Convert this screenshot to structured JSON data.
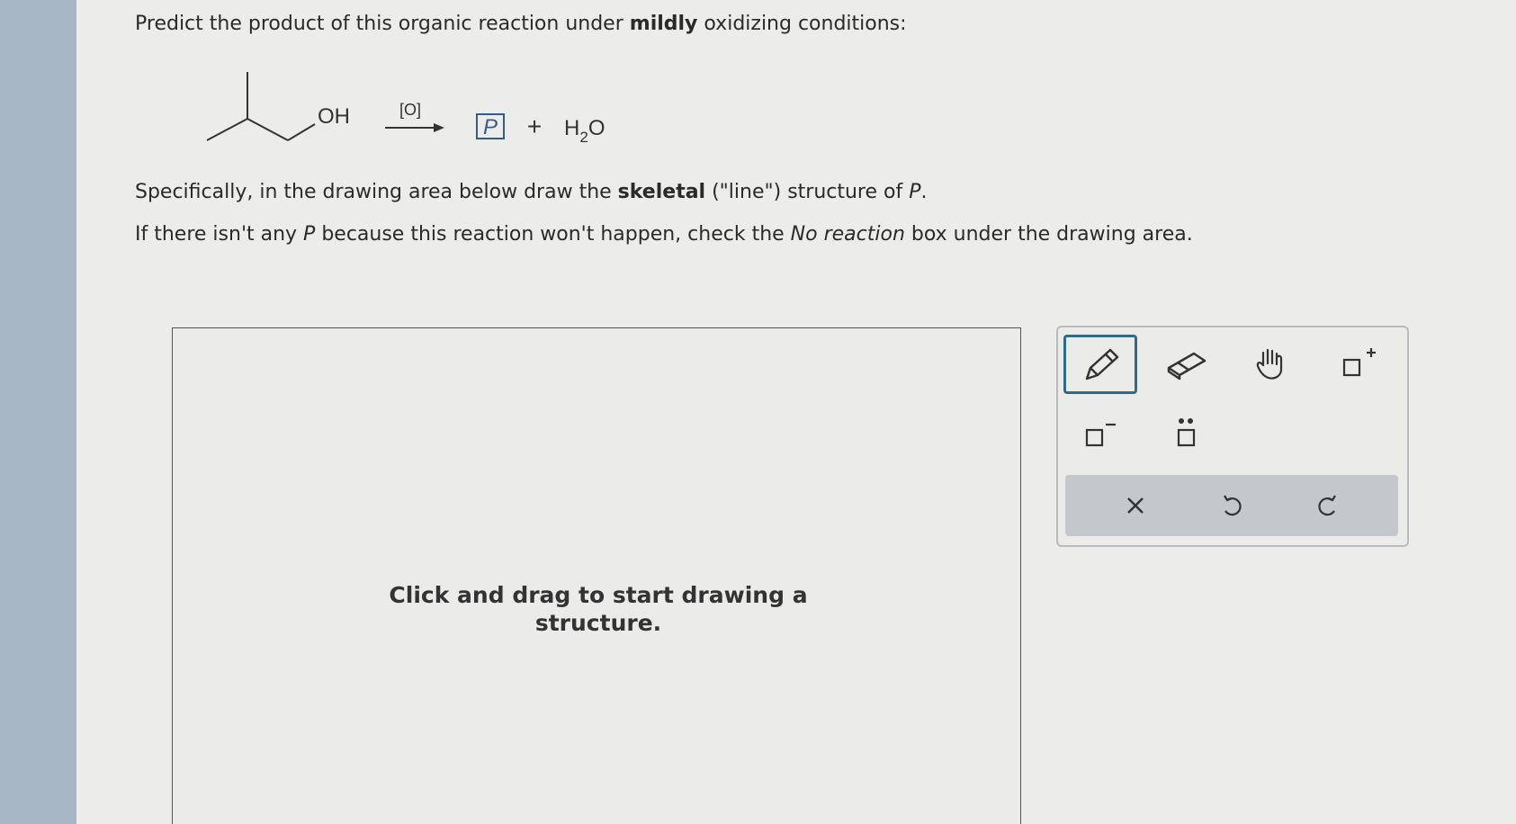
{
  "question": {
    "line1_pre": "Predict the product of this organic reaction under ",
    "line1_bold": "mildly",
    "line1_post": " oxidizing conditions:",
    "line2_pre": "Specifically, in the drawing area below draw the ",
    "line2_bold": "skeletal",
    "line2_mid": " (\"line\") structure of ",
    "line2_var": "P",
    "line2_post": ".",
    "line3_pre": "If there isn't any ",
    "line3_var": "P",
    "line3_mid": " because this reaction won't happen, check the ",
    "line3_ital": "No reaction",
    "line3_post": " box under the drawing area."
  },
  "reaction": {
    "reactant_label": "OH",
    "reagent": "[O]",
    "product_box": "P",
    "plus": "+",
    "byproduct_main": "H",
    "byproduct_sub": "2",
    "byproduct_end": "O"
  },
  "drawing_area": {
    "hint": "Click and drag to start drawing a structure."
  },
  "toolbox": {
    "tools": [
      "pencil-icon",
      "eraser-icon",
      "hand-icon",
      "add-charge-icon",
      "remove-charge-icon",
      "lone-pair-icon"
    ],
    "selected_tool": "pencil-icon",
    "actions": [
      "clear-icon",
      "undo-icon",
      "redo-icon"
    ]
  },
  "colors": {
    "accent": "#2f6a86",
    "action_bar": "#c3c8cc"
  }
}
